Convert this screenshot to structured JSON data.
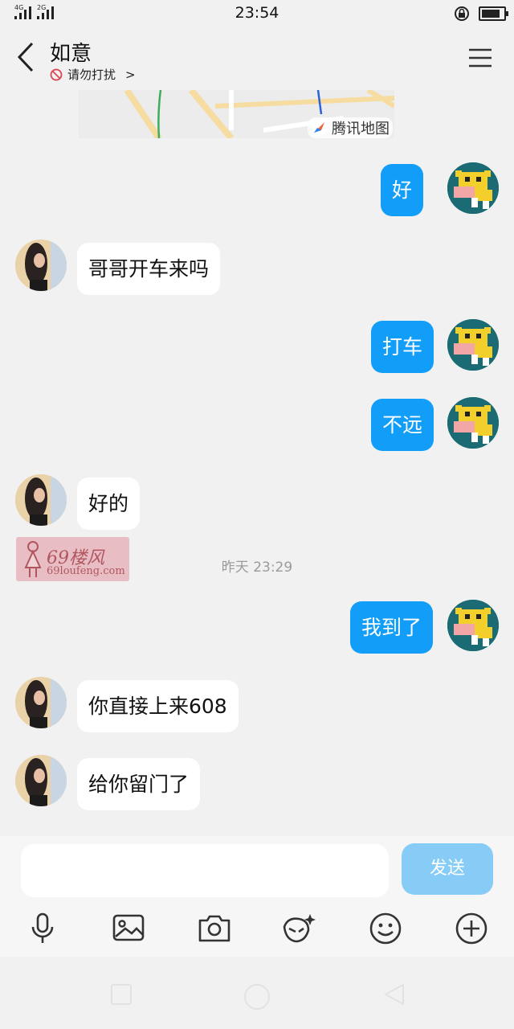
{
  "status": {
    "time": "23:54",
    "sig1_label": "4G",
    "sig2_label": "2G"
  },
  "header": {
    "title": "如意",
    "subtitle": "请勿打扰",
    "subtitle_arrow": ">"
  },
  "map": {
    "brand": "腾讯地图"
  },
  "messages": [
    {
      "side": "out",
      "text": "好"
    },
    {
      "side": "in",
      "text": "哥哥开车来吗"
    },
    {
      "side": "out",
      "text": "打车"
    },
    {
      "side": "out",
      "text": "不远"
    },
    {
      "side": "in",
      "text": "好的"
    },
    {
      "timestamp": "昨天 23:29"
    },
    {
      "side": "out",
      "text": "我到了"
    },
    {
      "side": "in",
      "text": "你直接上来608"
    },
    {
      "side": "in",
      "text": "给你留门了"
    }
  ],
  "watermark": {
    "line1": "69楼风",
    "line2": "69loufeng.com"
  },
  "composer": {
    "send_label": "发送",
    "input_value": ""
  },
  "colors": {
    "out_bubble": "#129ef8",
    "send_disabled": "#86ccf6"
  }
}
